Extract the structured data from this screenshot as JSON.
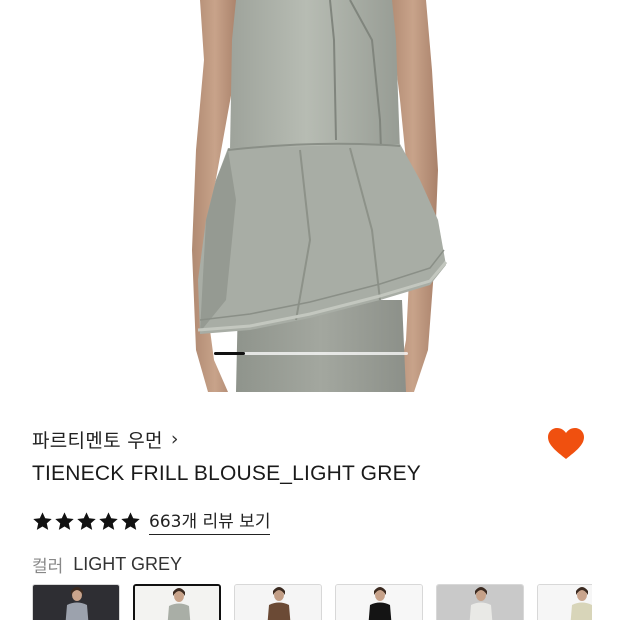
{
  "product": {
    "brand": "파르티멘토 우먼",
    "title": "TIENECK FRILL BLOUSE_LIGHT GREY",
    "rating": 5,
    "review_link": "663개 리뷰 보기",
    "color_label": "컬러",
    "color_value": "LIGHT GREY",
    "wishlisted": true
  },
  "gallery": {
    "progress": 0.16
  },
  "icons": {
    "brand_chevron": "chevron-right-icon",
    "wishlist": "heart-icon",
    "star": "star-icon"
  },
  "colors": {
    "heart": "#f0500f",
    "star": "#111111",
    "garment": "#a7aca4"
  },
  "swatches": [
    {
      "name": "swatch-1",
      "selected": false
    },
    {
      "name": "swatch-2",
      "selected": true
    },
    {
      "name": "swatch-3",
      "selected": false
    },
    {
      "name": "swatch-4",
      "selected": false
    },
    {
      "name": "swatch-5",
      "selected": false
    },
    {
      "name": "swatch-6",
      "selected": false
    }
  ]
}
